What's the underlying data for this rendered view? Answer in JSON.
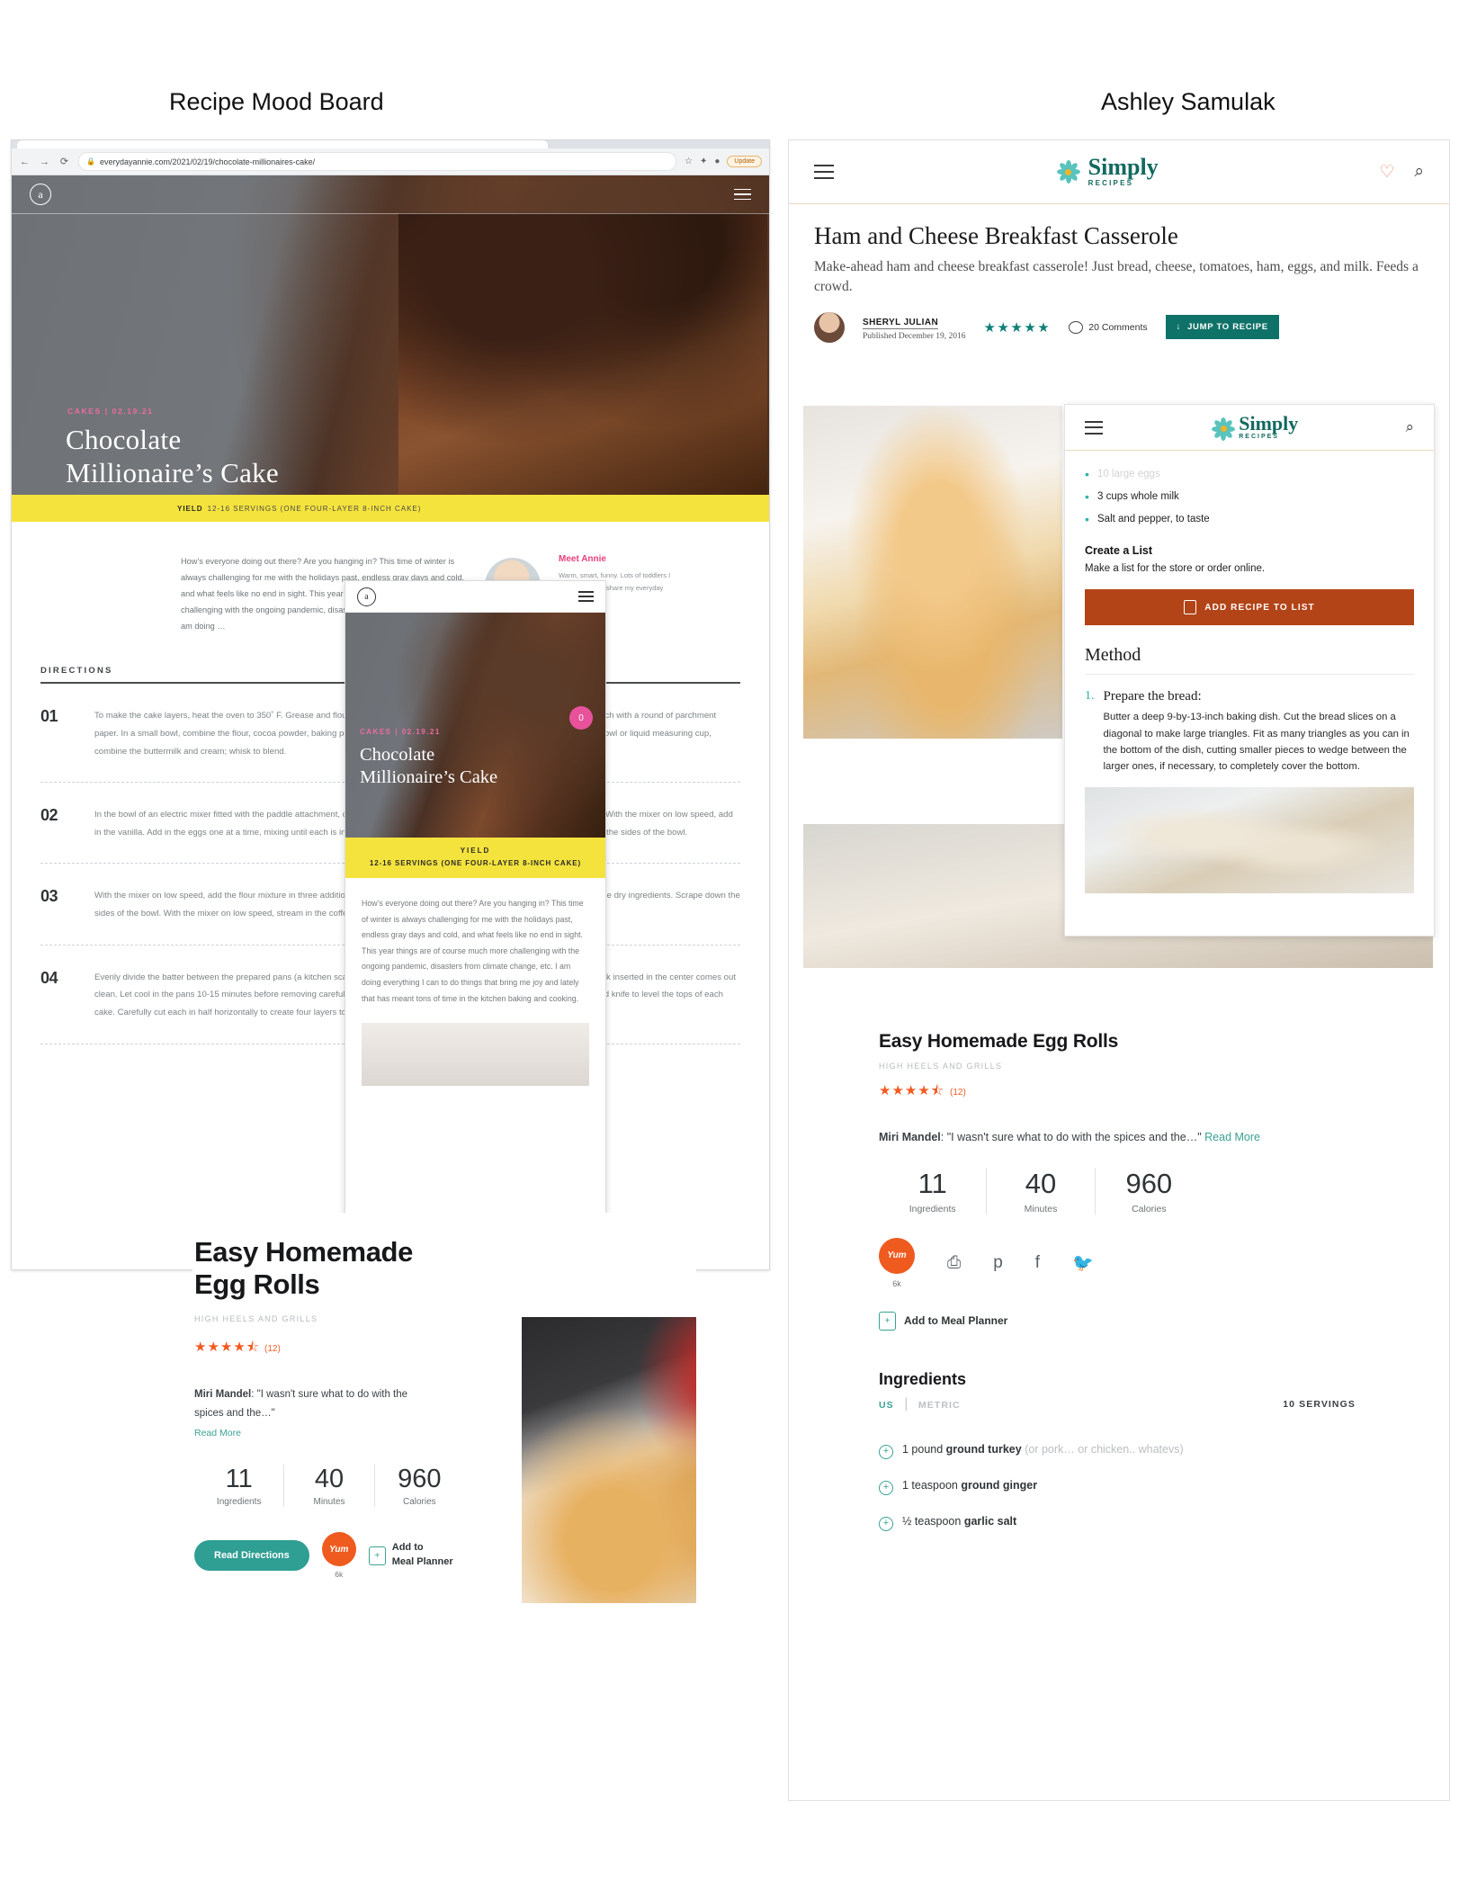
{
  "page": {
    "title": "Recipe Mood Board",
    "author": "Ashley Samulak"
  },
  "annie_browser": {
    "url": "everydayannie.com/2021/02/19/chocolate-millionaires-cake/",
    "back_icon": "←",
    "forward_icon": "→",
    "reload_icon": "⟳",
    "lock_icon": "🔒",
    "star_icon": "☆",
    "extensions_icon": "✦",
    "profile_icon": "●",
    "update_label": "Update",
    "logo_letter": "a",
    "category": "CAKES  |  02.19.21",
    "headline_line1": "Chocolate",
    "headline_line2": "Millionaire’s Cake",
    "yield_label": "YIELD",
    "yield_value": "12-16 SERVINGS (ONE FOUR-LAYER 8-INCH CAKE)",
    "intro": "How’s everyone doing out there? Are you hanging in? This time of winter is always challenging for me with the holidays past, endless gray days and cold, and what feels like no end in sight. This year things are of course much more challenging with the ongoing pandemic, disasters from climate change, etc. I am doing …",
    "meet_heading": "Meet Annie",
    "meet_text": "Warm, smart, funny. Lots of toddlers I love. Excited to share my everyday with you.",
    "directions_heading": "DIRECTIONS",
    "steps": [
      {
        "number": "01",
        "text": "To make the cake layers, heat the oven to 350˚ F. Grease and flour the edges of two 8-inch round cake pans and line the bottom of each with a round of parchment paper. In a small bowl, combine the flour, cocoa powder, baking powder, baking soda, and salt; whisk to blend. Set aside. In another bowl or liquid measuring cup, combine the buttermilk and cream; whisk to blend."
      },
      {
        "number": "02",
        "text": "In the bowl of an electric mixer fitted with the paddle attachment, combine the oil and sugar and beat on medium speed for 2 minutes. With the mixer on low speed, add in the vanilla. Add in the eggs one at a time, mixing until each is incorporated before adding the next. Stop the mixer and scrape down the sides of the bowl."
      },
      {
        "number": "03",
        "text": "With the mixer on low speed, add the flour mixture in three additions, alternating with the wet ingredients, beginning and ending with the dry ingredients. Scrape down the sides of the bowl. With the mixer on low speed, stream in the coffee and mix on medium-low just until blended, about 30 seconds."
      },
      {
        "number": "04",
        "text": "Evenly divide the batter between the prepared pans (a kitchen scale will help greatly with this!) Bake for 35-40 minutes, until a toothpick inserted in the center comes out clean. Let cool in the pans 10-15 minutes before removing carefully, peeling away the parchment, onto a wire rack. Use a long serrated knife to level the tops of each cake. Carefully cut each in half horizontally to create four layers total."
      }
    ]
  },
  "annie_mobile": {
    "logo_letter": "a",
    "category": "CAKES  |  02.19.21",
    "headline_line1": "Chocolate",
    "headline_line2": "Millionaire’s Cake",
    "badge": "0",
    "yield_label": "YIELD",
    "yield_value": "12-16 SERVINGS (ONE FOUR-LAYER 8-INCH CAKE)",
    "body": "How’s everyone doing out there? Are you hanging in? This time of winter is always challenging for me with the holidays past, endless gray days and cold, and what feels like no end in sight. This year things are of course much more challenging with the ongoing pandemic, disasters from climate change, etc. I am doing everything I can to do things that bring me joy and lately that has meant tons of time in the kitchen baking and cooking."
  },
  "egg_rolls_left": {
    "title": "Easy Homemade Egg Rolls",
    "source": "HIGH HEELS AND GRILLS",
    "stars": "★★★★⯪",
    "rating_count": "(12)",
    "reviewer": "Miri Mandel",
    "quote": ": \"I wasn't sure what to do with the spices and the…\"",
    "read_more": "Read More",
    "stats": [
      {
        "value": "11",
        "label": "Ingredients"
      },
      {
        "value": "40",
        "label": "Minutes"
      },
      {
        "value": "960",
        "label": "Calories"
      }
    ],
    "read_button": "Read Directions",
    "yum_label": "Yum",
    "yum_count": "6k",
    "planner_icon": "+",
    "planner_line1": "Add to",
    "planner_line2": "Meal Planner"
  },
  "simply": {
    "brand_name": "Simply",
    "brand_sub": "RECIPES",
    "heart_icon": "♡",
    "search_icon": "⌕",
    "title": "Ham and Cheese Breakfast Casserole",
    "dek": "Make-ahead ham and cheese breakfast casserole! Just bread, cheese, tomatoes, ham, eggs, and milk. Feeds a crowd.",
    "author": "SHERYL JULIAN",
    "published": "Published December 19, 2016",
    "stars": "★★★★★",
    "comments": "20 Comments",
    "jump_icon": "↓",
    "jump_label": "JUMP TO RECIPE"
  },
  "simply_mobile": {
    "brand_name": "Simply",
    "brand_sub": "RECIPES",
    "search_icon": "⌕",
    "ingredients": [
      "10 large eggs",
      "3 cups whole milk",
      "Salt and pepper, to taste"
    ],
    "create_list_heading": "Create a List",
    "create_list_text": "Make a list for the store or order online.",
    "add_recipe_button": "ADD RECIPE TO LIST",
    "method_heading": "Method",
    "step_number": "1.",
    "step_heading": "Prepare the bread:",
    "step_text": "Butter a deep 9-by-13-inch baking dish. Cut the bread slices on a diagonal to make large triangles. Fit as many triangles as you can in the bottom of the dish, cutting smaller pieces to wedge between the larger ones, if necessary, to completely cover the bottom."
  },
  "egg_rolls_right": {
    "title": "Easy Homemade Egg Rolls",
    "source": "HIGH HEELS AND GRILLS",
    "stars": "★★★★⯪",
    "rating_count": "(12)",
    "reviewer": "Miri Mandel",
    "quote": ": \"I wasn't sure what to do with the spices and the…\"",
    "read_more": "Read More",
    "stats": [
      {
        "value": "11",
        "label": "Ingredients"
      },
      {
        "value": "40",
        "label": "Minutes"
      },
      {
        "value": "960",
        "label": "Calories"
      }
    ],
    "yum_label": "Yum",
    "yum_count": "6k",
    "print_icon": "⎙",
    "pinterest_icon": "p",
    "facebook_icon": "f",
    "twitter_icon": "🐦",
    "planner_icon": "+",
    "planner_label": "Add to Meal Planner",
    "ingredients_heading": "Ingredients",
    "unit_us": "US",
    "unit_divider": "|",
    "unit_metric": "METRIC",
    "servings": "10 SERVINGS",
    "ingredients": [
      {
        "qty": "1 pound ",
        "name": "ground turkey",
        "note": " (or pork… or chicken.. whatevs)"
      },
      {
        "qty": "1 teaspoon ",
        "name": "ground ginger",
        "note": ""
      },
      {
        "qty": "½ teaspoon ",
        "name": "garlic salt",
        "note": ""
      }
    ]
  },
  "colors": {
    "annie_yellow": "#f5e33d",
    "annie_pink": "#f06aa0",
    "simply_teal": "#0f7268",
    "simply_orange": "#b34418",
    "yummly_orange": "#f15a22",
    "yummly_teal": "#2f9e93"
  }
}
